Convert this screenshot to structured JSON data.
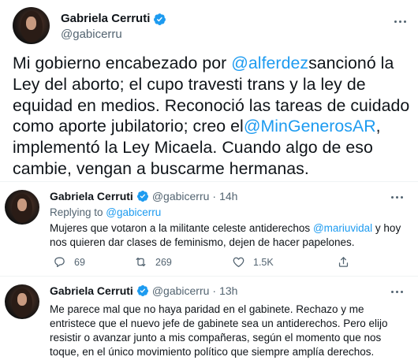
{
  "main_tweet": {
    "author_name": "Gabriela Cerruti",
    "author_handle": "@gabicerru",
    "text": {
      "part1": "Mi gobierno encabezado por ",
      "mention1": "@alferdez",
      "part2": "sancionó la Ley del aborto; el cupo travesti trans y la ley de equidad en medios. Reconoció las tareas de cuidado como aporte jubilatorio; creo el",
      "mention2": "@MinGenerosAR",
      "part3": ", implementó la Ley Micaela. Cuando algo de eso cambie, vengan a buscarme hermanas."
    },
    "icons": {
      "verified": "verified-badge-icon",
      "more": "more-options-icon"
    }
  },
  "replies": [
    {
      "author_name": "Gabriela Cerruti",
      "author_handle": "@gabicerru",
      "separator": "·",
      "time": "14h",
      "replying_label": "Replying to ",
      "replying_handle": "@gabicerru",
      "text": {
        "part1": "Mujeres que votaron a la militante celeste antiderechos ",
        "mention1": "@mariuvidal",
        "part2": " y hoy nos quieren dar clases de feminismo, dejen de hacer papelones."
      },
      "counts": {
        "replies": "69",
        "retweets": "269",
        "likes": "1.5K"
      }
    },
    {
      "author_name": "Gabriela Cerruti",
      "author_handle": "@gabicerru",
      "separator": "·",
      "time": "13h",
      "text": "Me parece mal que no haya paridad en el gabinete. Rechazo y me entristece que el nuevo jefe de gabinete sea un antiderechos. Pero elijo resistir o avanzar junto a mis compañeras, según el momento que nos toque, en el único movimiento político que siempre amplía derechos."
    }
  ],
  "colors": {
    "accent": "#1d9bf0",
    "text": "#0f1419",
    "muted": "#536471",
    "divider": "#eff3f4"
  }
}
